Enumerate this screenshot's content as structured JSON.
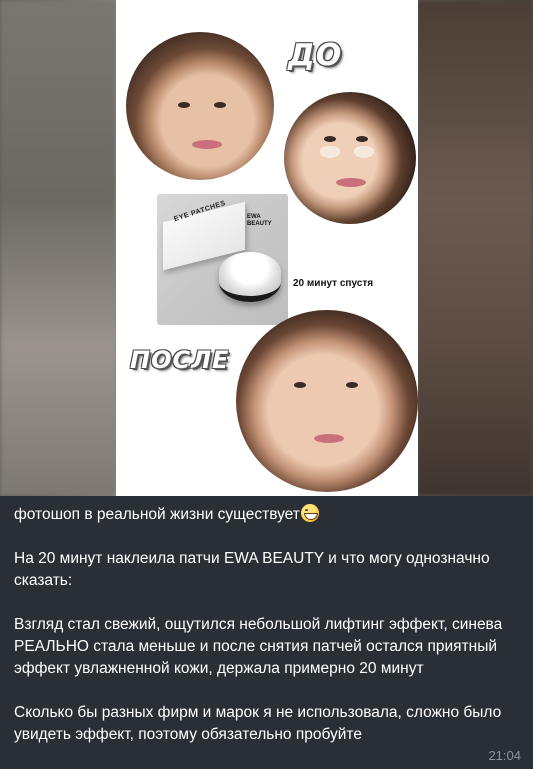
{
  "media": {
    "label_before": "ДО",
    "label_after": "ПОСЛЕ",
    "label_minutes": "20 минут спустя",
    "product_box_text": "EYE PATCHES",
    "product_jar_text": "EWA BEAUTY",
    "icon_emoji": "grinning-face-emoji"
  },
  "message": {
    "line1": "фотошоп в реальной жизни существует",
    "para2": "На 20 минут наклеила патчи EWA BEAUTY и что могу однозначно сказать:",
    "para3": "Взгляд стал свежий, ощутился небольшой лифтинг эффект, синева РЕАЛЬНО стала меньше и после снятия патчей остался приятный эффект увлажненной кожи, держала примерно 20 минут",
    "para4": "Сколько бы разных фирм и марок я не использовала, сложно было увидеть эффект, поэтому обязательно пробуйте",
    "time": "21:04"
  },
  "colors": {
    "background": "#2a2f36",
    "text": "#ffffff",
    "time": "#8b939c"
  }
}
